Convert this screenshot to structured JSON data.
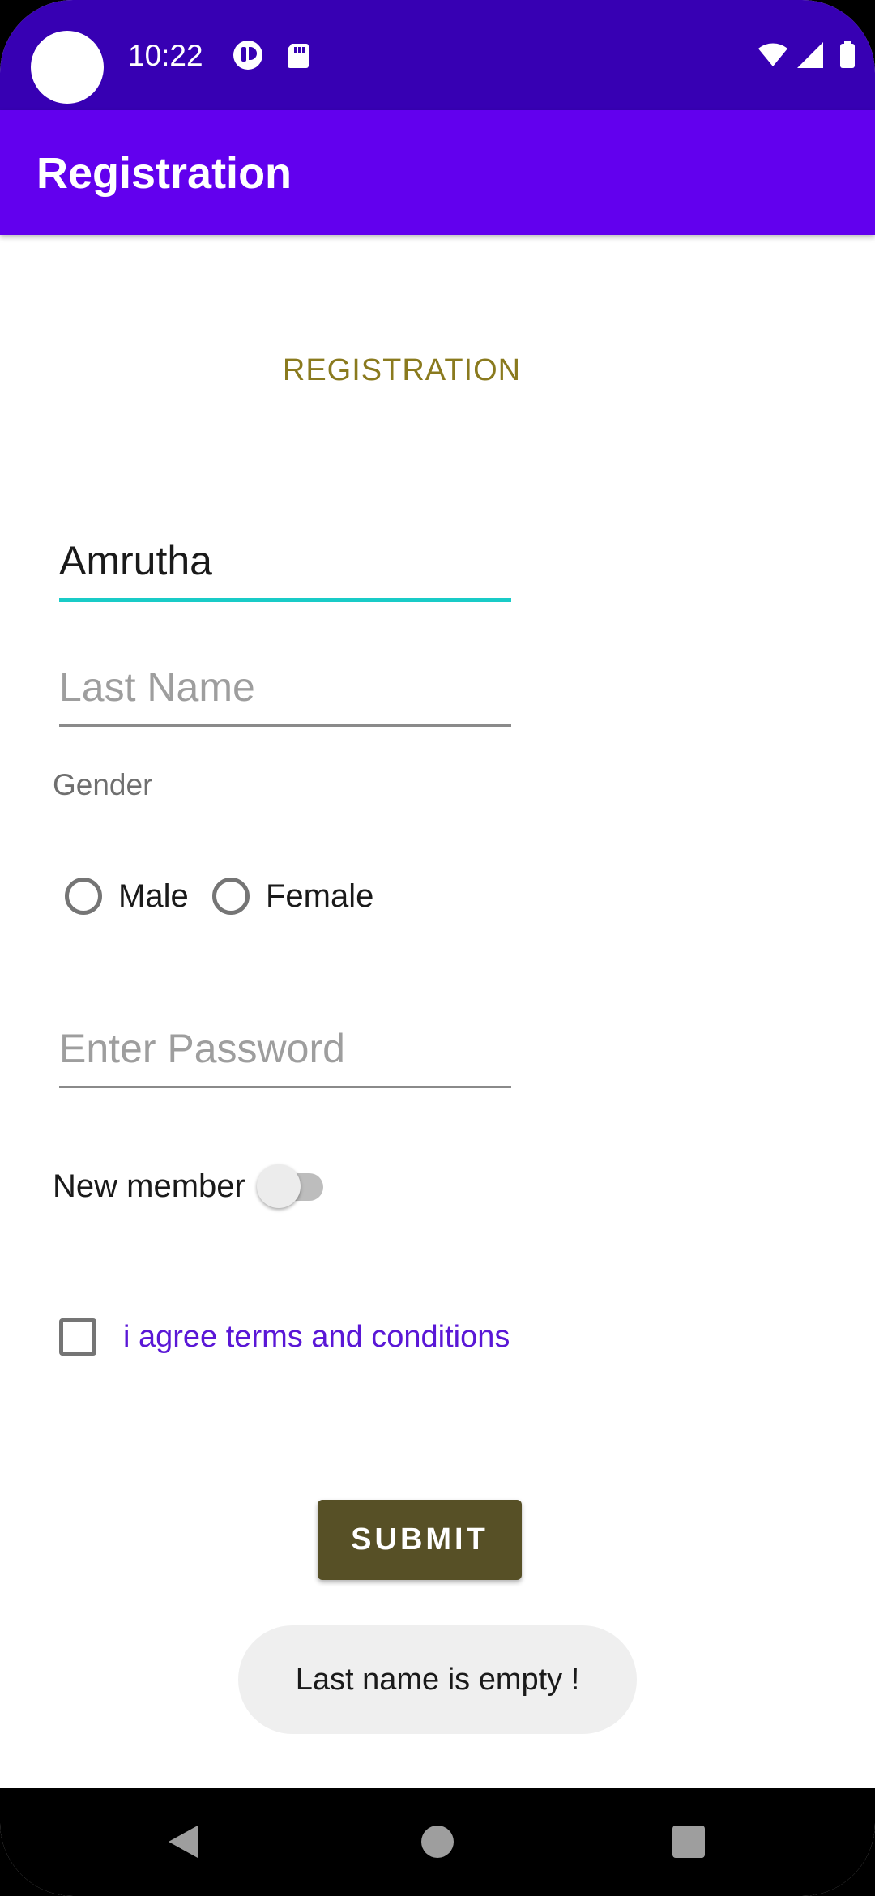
{
  "status_bar": {
    "time": "10:22",
    "background": "#3700b3",
    "left_icons": [
      "app-notification-icon",
      "sd-card-icon"
    ],
    "right_icons": [
      "wifi-icon",
      "cell-signal-icon",
      "battery-icon"
    ]
  },
  "app_bar": {
    "title": "Registration",
    "background": "#6200ee"
  },
  "form": {
    "heading": "REGISTRATION",
    "first_name": {
      "value": "Amrutha",
      "placeholder": ""
    },
    "last_name": {
      "value": "",
      "placeholder": "Last Name"
    },
    "gender_label": "Gender",
    "gender_options": [
      {
        "label": "Male",
        "checked": false
      },
      {
        "label": "Female",
        "checked": false
      }
    ],
    "password": {
      "value": "",
      "placeholder": "Enter Password"
    },
    "new_member": {
      "label": "New member",
      "on": false
    },
    "terms": {
      "label": "i agree terms and conditions",
      "checked": false
    },
    "submit_label": "SUBMIT"
  },
  "toast": {
    "message": "Last name is empty !"
  },
  "nav_bar": {
    "buttons": [
      "back-icon",
      "home-icon",
      "recents-icon"
    ]
  },
  "colors": {
    "accent_focus": "#19cbc7",
    "heading": "#8a7a1e",
    "submit": "#575026",
    "link": "#5a17d6"
  }
}
